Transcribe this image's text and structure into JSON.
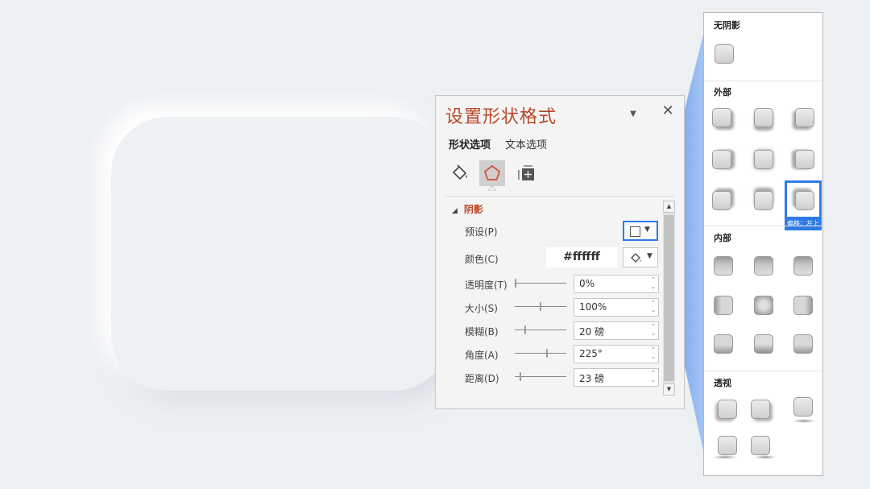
{
  "pane": {
    "title": "设置形状格式",
    "dropdown_icon": "▼",
    "close_icon": "✕",
    "tabs": [
      "形状选项",
      "文本选项"
    ],
    "section_title": "阴影",
    "section_triangle": "◢",
    "preset_label": "预设(P)",
    "preset_caret": "▼",
    "color_label": "颜色(C)",
    "color_value": "#ffffff",
    "color_caret": "▼",
    "properties": [
      {
        "label": "透明度(T)",
        "value": "0%",
        "level": 0.0
      },
      {
        "label": "大小(S)",
        "value": "100%",
        "level": 0.5
      },
      {
        "label": "模糊(B)",
        "value": "20 磅",
        "level": 0.2
      },
      {
        "label": "角度(A)",
        "value": "225°",
        "level": 0.625
      },
      {
        "label": "距离(D)",
        "value": "23 磅",
        "level": 0.1
      }
    ],
    "spin_arrows": "⌃⌄",
    "scroll_up": "▲",
    "scroll_down": "▼",
    "accent_color": "#b7472a",
    "highlight_color": "#2d7be5"
  },
  "gallery": {
    "sections": [
      "无阴影",
      "外部",
      "内部",
      "透视"
    ],
    "selected_tooltip": "偏移：左上"
  }
}
